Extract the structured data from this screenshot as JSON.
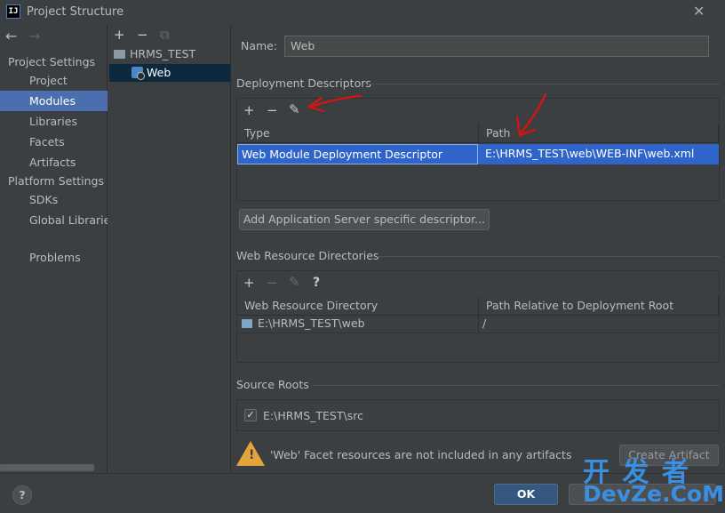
{
  "window": {
    "title": "Project Structure",
    "app_icon": "IJ"
  },
  "sidebar": {
    "project_settings_label": "Project Settings",
    "project_items": [
      "Project",
      "Modules",
      "Libraries",
      "Facets",
      "Artifacts"
    ],
    "platform_settings_label": "Platform Settings",
    "platform_items": [
      "SDKs",
      "Global Libraries"
    ],
    "problems": "Problems",
    "selected": "Modules"
  },
  "tree": {
    "root": "HRMS_TEST",
    "child": "Web"
  },
  "detail": {
    "name_label": "Name:",
    "name_value": "Web",
    "deployment": {
      "title": "Deployment Descriptors",
      "columns": [
        "Type",
        "Path"
      ],
      "rows": [
        {
          "type": "Web Module Deployment Descriptor",
          "path": "E:\\HRMS_TEST\\web\\WEB-INF\\web.xml"
        }
      ],
      "add_server_button": "Add Application Server specific descriptor..."
    },
    "resources": {
      "title": "Web Resource Directories",
      "help": "?",
      "columns": [
        "Web Resource Directory",
        "Path Relative to Deployment Root"
      ],
      "rows": [
        {
          "dir": "E:\\HRMS_TEST\\web",
          "relative": "/"
        }
      ]
    },
    "source_roots": {
      "title": "Source Roots",
      "items": [
        {
          "path": "E:\\HRMS_TEST\\src",
          "checked": true
        }
      ]
    },
    "warning": {
      "text": "'Web' Facet resources are not included in any artifacts",
      "button": "Create Artifact"
    }
  },
  "footer": {
    "ok": "OK",
    "help": "?"
  },
  "watermark": {
    "line1": "开 发 者",
    "line2": "DevZe.CoM"
  },
  "colors": {
    "selection": "#4b6eaf",
    "row_selection": "#2f65ca",
    "annotation": "#e01010",
    "watermark": "#3b8fe0",
    "warning": "#e3a53a"
  }
}
